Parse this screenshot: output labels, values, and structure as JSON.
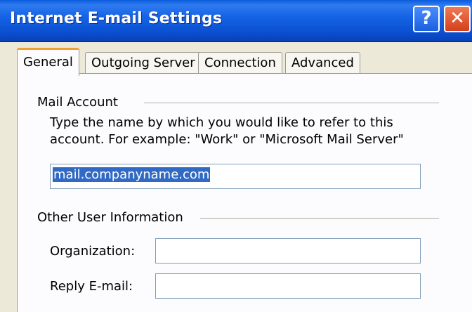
{
  "window": {
    "title": "Internet E-mail Settings",
    "help_label": "?",
    "close_label": "✕"
  },
  "tabs": [
    {
      "label": "General",
      "active": true
    },
    {
      "label": "Outgoing Server",
      "active": false
    },
    {
      "label": "Connection",
      "active": false
    },
    {
      "label": "Advanced",
      "active": false
    }
  ],
  "mail_account": {
    "group_label": "Mail Account",
    "description_line1": "Type the name by which you would like to refer to this",
    "description_line2": "account.  For example: \"Work\" or \"Microsoft Mail Server\"",
    "account_name_value": "mail.companyname.com"
  },
  "other_user_info": {
    "group_label": "Other User Information",
    "organization_label": "Organization:",
    "organization_value": "",
    "reply_email_label": "Reply E-mail:",
    "reply_email_value": ""
  },
  "colors": {
    "titlebar": "#0a4fd0",
    "dialog_bg": "#ece9d8",
    "selection": "#316ac5",
    "active_tab_accent": "#f0a030"
  }
}
